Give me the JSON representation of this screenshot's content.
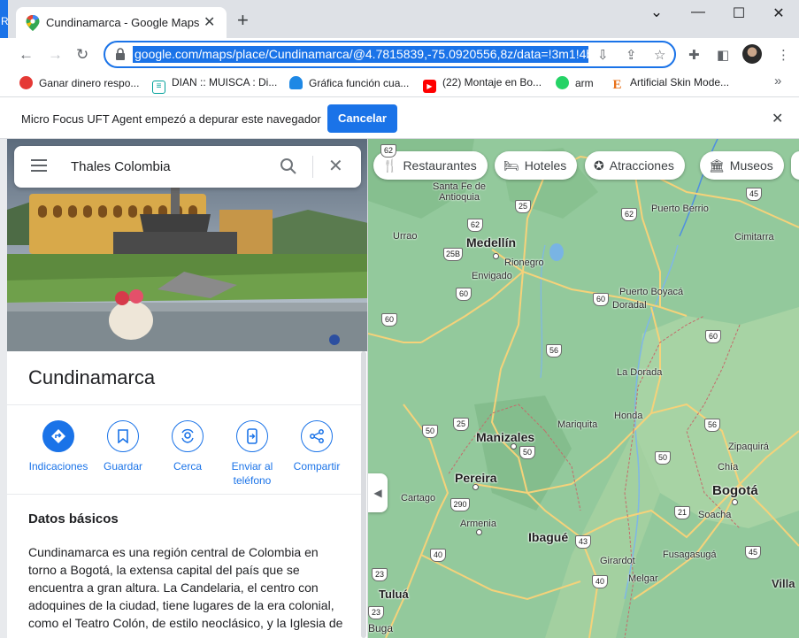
{
  "browser": {
    "left_sliver_text": "R",
    "tab_title": "Cundinamarca - Google Maps",
    "tab_close": "✕",
    "new_tab": "+",
    "window_controls": {
      "minimize": "—",
      "maximize": "☐",
      "close": "✕",
      "tab_search": "⌄"
    },
    "url": "google.com/maps/place/Cundinamarca/@4.7815839,-75.0920556,8z/data=!3m1!4b"
  },
  "bookmarks": [
    {
      "label": "Ganar dinero respo...",
      "icon": "circle-red-icon",
      "color": "#e53935",
      "glyph": ""
    },
    {
      "label": "DIAN :: MUISCA : Di...",
      "icon": "dian-icon",
      "color": "#00a19a",
      "glyph": "≡"
    },
    {
      "label": "Gráfica función cua...",
      "icon": "cloud-icon",
      "color": "#1e88e5",
      "glyph": ""
    },
    {
      "label": "(22) Montaje en Bo...",
      "icon": "youtube-icon",
      "color": "#ff0000",
      "glyph": "▶"
    },
    {
      "label": "arm",
      "icon": "whatsapp-icon",
      "color": "#25d366",
      "glyph": ""
    },
    {
      "label": "Artificial Skin Mode...",
      "icon": "e-logo-icon",
      "color": "#ffffff",
      "glyph": "E"
    }
  ],
  "bookmarks_more": "»",
  "infobar": {
    "message": "Micro Focus UFT Agent empezó a depurar este navegador",
    "button": "Cancelar",
    "close": "✕"
  },
  "maps": {
    "search": {
      "value": "Thales Colombia"
    },
    "place_title": "Cundinamarca",
    "actions": [
      {
        "label": "Indicaciones",
        "icon": "directions-icon"
      },
      {
        "label": "Guardar",
        "icon": "bookmark-icon"
      },
      {
        "label": "Cerca",
        "icon": "nearby-icon"
      },
      {
        "label": "Enviar al teléfono",
        "icon": "send-to-phone-icon"
      },
      {
        "label": "Compartir",
        "icon": "share-icon"
      }
    ],
    "basics_title": "Datos básicos",
    "basics_text": "Cundinamarca es una región central de Colombia en torno a Bogotá, la extensa capital del país que se encuentra a gran altura. La Candelaria, el centro con adoquines de la ciudad, tiene lugares de la era colonial, como el Teatro Colón, de estilo neoclásico, y la Iglesia de",
    "chips": [
      {
        "label": "Restaurantes",
        "icon": "restaurant-icon"
      },
      {
        "label": "Hoteles",
        "icon": "hotel-icon"
      },
      {
        "label": "Atracciones",
        "icon": "attractions-icon"
      },
      {
        "label": "Museos",
        "icon": "museum-icon"
      }
    ],
    "cities": [
      "Medellín",
      "Manizales",
      "Pereira",
      "Ibagué",
      "Bogotá",
      "Tuluá"
    ],
    "towns": [
      "Santa Fe de Antioquia",
      "Urrao",
      "Rionegro",
      "Envigado",
      "Puerto Berrio",
      "Cimitarra",
      "Puerto Boyacá",
      "Doradal",
      "La Dorada",
      "Honda",
      "Mariquita",
      "Cartago",
      "Armenia",
      "Zipaquirá",
      "Chía",
      "Soacha",
      "Fusagasugá",
      "Girardot",
      "Melgar",
      "Villa",
      "Buga"
    ],
    "route_shields": [
      "62",
      "25",
      "62",
      "45",
      "25B",
      "60",
      "60",
      "60",
      "60",
      "56",
      "50",
      "25",
      "50",
      "56",
      "50",
      "290",
      "21",
      "43",
      "40",
      "40",
      "45",
      "23",
      "23"
    ]
  }
}
